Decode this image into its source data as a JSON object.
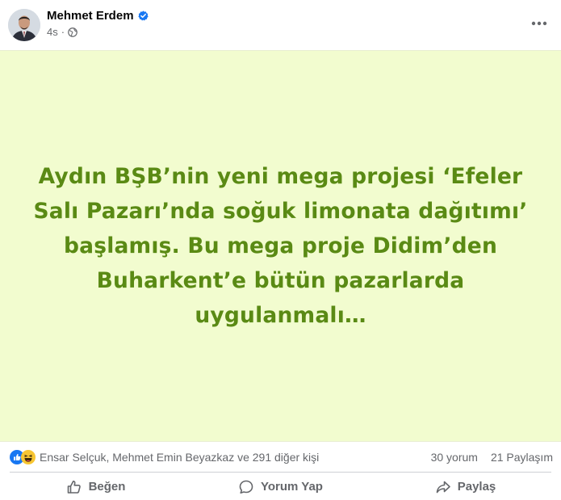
{
  "author": {
    "name": "Mehmet Erdem",
    "verified": true,
    "time": "4s",
    "audience_icon": "globe-icon"
  },
  "post": {
    "text": "Aydın BŞB’nin yeni mega projesi ‘Efeler Salı Pazarı’nda soğuk limonata dağıtımı’ başlamış. Bu mega proje Didim’den Buharkent’e bütün pazarlarda uygulanmalı…",
    "background_color": "#f2fccf",
    "text_color": "#5a8a14"
  },
  "stats": {
    "reaction_icons": [
      "like-icon",
      "haha-icon"
    ],
    "reactors": "Ensar Selçuk, Mehmet Emin Beyazkaz ve 291 diğer kişi",
    "comments": "30 yorum",
    "shares": "21 Paylaşım"
  },
  "actions": {
    "like": "Beğen",
    "comment": "Yorum Yap",
    "share": "Paylaş"
  },
  "colors": {
    "accent_blue": "#1877f2",
    "secondary_text": "#65676b"
  }
}
